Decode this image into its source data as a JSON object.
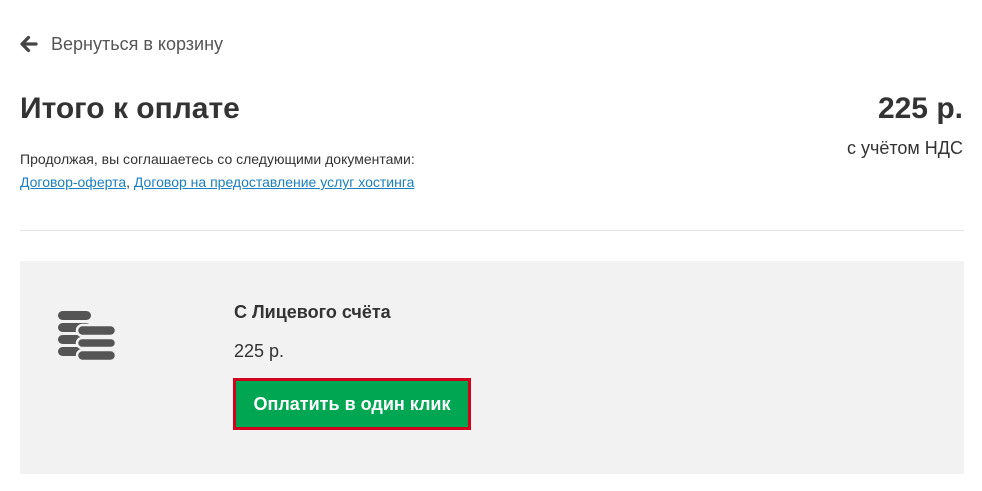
{
  "back_link": {
    "icon": "arrow-left-icon",
    "label": "Вернуться в корзину"
  },
  "summary": {
    "title": "Итого к оплате",
    "agree_text": "Продолжая, вы соглашаетесь со следующими документами:",
    "documents": [
      {
        "label": "Договор-оферта"
      },
      {
        "label": "Договор на предоставление услуг хостинга"
      }
    ],
    "separator": ", ",
    "total": "225 р.",
    "vat_note": "с учётом НДС"
  },
  "payment_method": {
    "icon": "coins-icon",
    "title": "С Лицевого счёта",
    "amount": "225 р.",
    "button_label": "Оплатить в один клик"
  },
  "colors": {
    "link": "#1a7fc1",
    "button_bg": "#00a651",
    "button_border": "#d0021b",
    "panel_bg": "#f2f2f2",
    "text": "#333333"
  }
}
